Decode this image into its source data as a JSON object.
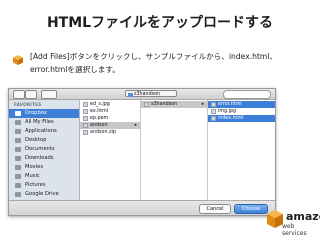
{
  "slide": {
    "title": "HTMLファイルをアップロードする",
    "instruction": "[Add Files]ボタンをクリックし、サンプルファイルから、index.html、error.htmlを選択します。"
  },
  "dialog": {
    "location": "s3handson",
    "sidebar": {
      "favorites_heading": "FAVORITES",
      "devices_heading": "DEVICES",
      "items": [
        {
          "label": "Dropbox",
          "selected": true
        },
        {
          "label": "All My Files",
          "selected": false
        },
        {
          "label": "Applications",
          "selected": false
        },
        {
          "label": "Desktop",
          "selected": false
        },
        {
          "label": "Documents",
          "selected": false
        },
        {
          "label": "Downloads",
          "selected": false
        },
        {
          "label": "Movies",
          "selected": false
        },
        {
          "label": "Music",
          "selected": false
        },
        {
          "label": "Pictures",
          "selected": false
        },
        {
          "label": "Google Drive",
          "selected": false
        }
      ]
    },
    "column1": [
      "ed_s.jpg",
      "ex.html",
      "ep.pem",
      "andson",
      "andson.zip"
    ],
    "column2": [
      "s3handson"
    ],
    "column3": [
      "error.html",
      "img.jpg",
      "index.html"
    ],
    "buttons": {
      "cancel": "Cancel",
      "choose": "Choose"
    }
  },
  "logo": {
    "line1": "amazon",
    "line2": "web services"
  },
  "colors": {
    "selection": "#3d7fd8",
    "sidebar_bg": "#dde3ea",
    "aws_orange": "#f29a1f"
  }
}
